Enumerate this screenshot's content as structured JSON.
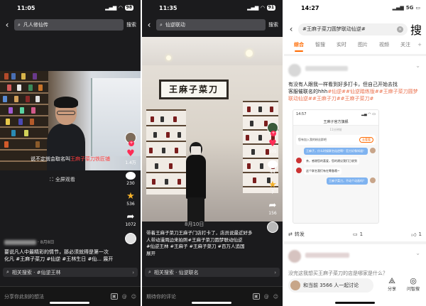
{
  "panel1": {
    "time": "11:05",
    "battery": "98",
    "search_query": "凡人修仙传",
    "search_btn": "搜索",
    "subtitle_before": "说不定就会取名叫",
    "subtitle_highlight": "王麻子菜刀铁匠铺",
    "fullscreen": "全屏观看",
    "rail": {
      "likes": "1.4万",
      "comments": "230",
      "stars": "536",
      "shares": "1072"
    },
    "meta_date": "· 8月8日",
    "caption_line1": "要说凡人中最精彩的情节，那必须就得是第一次",
    "caption_line2": "化凡 #王麻子菜刀 #仙逆 #王林生日 #仙... 展开",
    "related": "相关搜索 · #仙逆王林",
    "comment_placeholder": "分享你此刻的想法"
  },
  "panel2": {
    "time": "11:35",
    "battery": "91",
    "search_query": "仙逆联动",
    "search_btn": "搜索",
    "sign_text": "王麻子菜刀",
    "rail": {
      "likes": "105",
      "comments": "44",
      "stars": "7",
      "shares": "156"
    },
    "date": "8月10日",
    "caption_line1": "带着王麻子菜刀王麻子门店打卡了，店员说最近好多",
    "caption_line2": "人带动漫周边来拍照#王麻子菜刀圆梦联动仙逆",
    "caption_line3": "#仙逆王林 #王麻子 #王麻子菜刀 #百万人追国",
    "caption_line4": "展开",
    "related": "相关搜索 · 仙逆联名",
    "comment_placeholder": "期待你的评论"
  },
  "panel3": {
    "time": "14:27",
    "network": "5G",
    "search_query": "#王麻子菜刀圆梦联动仙逆#",
    "search_btn": "搜",
    "tabs": [
      "综合",
      "智搜",
      "实时",
      "图片",
      "视频",
      "关注"
    ],
    "post_line1": "有没有人跟我一样看到好多打卡，但自己开始去找",
    "post_line2": "客服催联名的hhh",
    "post_tags": "#仙逆##仙逆踏练版##王麻子菜刀圆梦联动仙逆##王麻子刀##王麻子菜刀#",
    "chat": {
      "time": "14:57",
      "header": "王麻子官方旗舰",
      "ts": "11分钟前",
      "sys_text": "您有加入我的粉丝群吧",
      "sys_btn": "去看看",
      "msg1": "王麻子，什么时候联名仙逆啊！官方好像知道！",
      "msg2": "亲，感谢您的喜爱，您的建议我们已收到",
      "msg3": "这个联名我们有在筹备哦~",
      "msg4": "王麻子菜刀，不动个动画吗？"
    },
    "actions": {
      "share": "转发",
      "comment": "1",
      "like": "1"
    },
    "bottom_input": "和当前 3566 人一起讨论",
    "bottom_share": "分享",
    "bottom_ask": "问智搜",
    "next_post_line": "没完这我想买王麻子菜刀的店是哪家是什么？"
  }
}
